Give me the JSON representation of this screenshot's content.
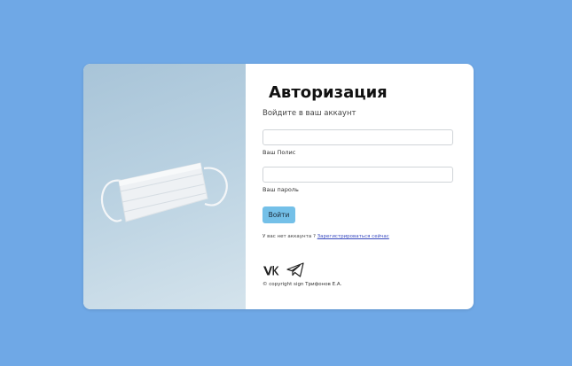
{
  "login": {
    "title": "Авторизация",
    "subtitle": "Войдите в ваш аккаунт",
    "polis_label": "Ваш Полис",
    "polis_value": "",
    "password_label": "Ваш пароль",
    "password_value": "",
    "submit_label": "Войти",
    "no_account_text": "У вас нет аккаунта ?",
    "register_link": "Зарегистрироваться сейчас",
    "copyright": "© copyright sign Трифонов Е.А."
  },
  "social": {
    "icons": [
      "vk-icon",
      "telegram-icon"
    ]
  },
  "colors": {
    "background": "#6fa8e6",
    "button": "#74c0e8",
    "link": "#3b4cc0"
  }
}
